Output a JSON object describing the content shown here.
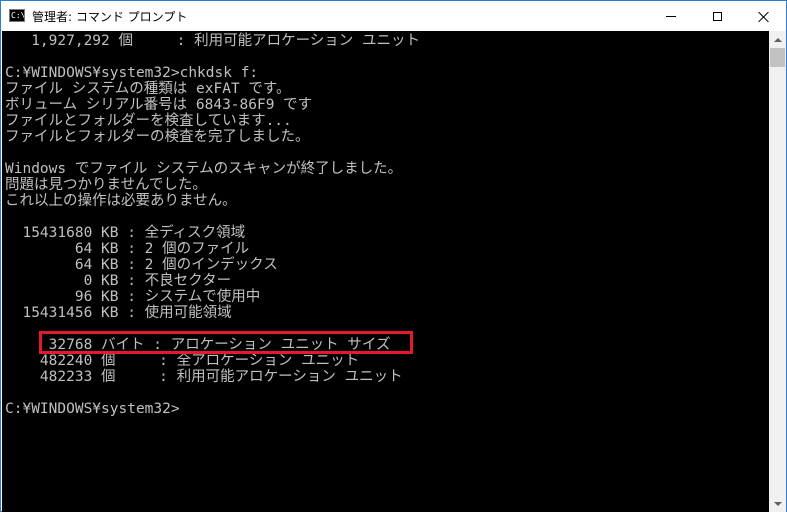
{
  "window": {
    "title": "管理者: コマンド プロンプト",
    "icon_glyph": "C:\\_"
  },
  "console": {
    "lines": [
      "   1,927,292 個     : 利用可能アロケーション ユニット",
      "",
      "C:¥WINDOWS¥system32>chkdsk f:",
      "ファイル システムの種類は exFAT です。",
      "ボリューム シリアル番号は 6843-86F9 です",
      "ファイルとフォルダーを検査しています...",
      "ファイルとフォルダーの検査を完了しました。",
      "",
      "Windows でファイル システムのスキャンが終了しました。",
      "問題は見つかりませんでした。",
      "これ以上の操作は必要ありません。",
      "",
      "  15431680 KB : 全ディスク領域",
      "        64 KB : 2 個のファイル",
      "        64 KB : 2 個のインデックス",
      "         0 KB : 不良セクター",
      "        96 KB : システムで使用中",
      "  15431456 KB : 使用可能領域",
      "",
      "     32768 バイト : アロケーション ユニット サイズ",
      "    482240 個     : 全アロケーション ユニット",
      "    482233 個     : 利用可能アロケーション ユニット",
      "",
      "C:¥WINDOWS¥system32>"
    ]
  },
  "colors": {
    "console_bg": "#000000",
    "console_text": "#c0c0c0",
    "highlight_border": "#e8182c",
    "window_border": "#2b7bd8"
  },
  "icons": {
    "app": "console-icon",
    "minimize": "minimize-icon",
    "maximize": "maximize-icon",
    "close": "close-icon",
    "scroll_up": "arrow-up-icon",
    "scroll_down": "arrow-down-icon"
  }
}
